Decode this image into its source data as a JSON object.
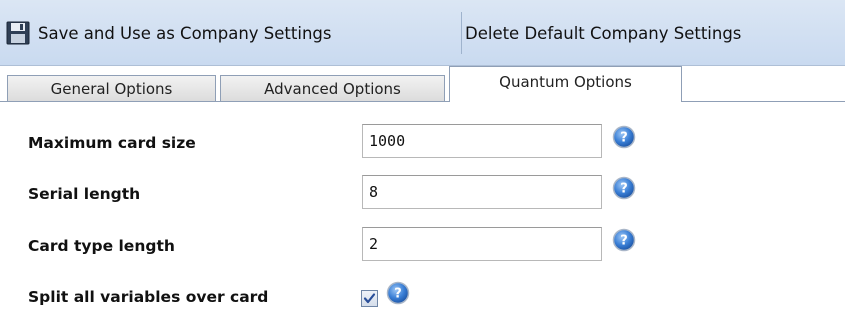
{
  "toolbar": {
    "save_label": "Save and Use as Company Settings",
    "save_icon": "floppy-disk-icon",
    "delete_label": "Delete Default Company Settings"
  },
  "tabs": [
    {
      "label": "General Options",
      "active": false
    },
    {
      "label": "Advanced Options",
      "active": false
    },
    {
      "label": "Quantum Options",
      "active": true
    }
  ],
  "form": {
    "max_card_size": {
      "label": "Maximum card size",
      "value": "1000",
      "help_icon": "help-question-icon"
    },
    "serial_length": {
      "label": "Serial length",
      "value": "8",
      "help_icon": "help-question-icon"
    },
    "card_type_length": {
      "label": "Card type length",
      "value": "2",
      "help_icon": "help-question-icon"
    },
    "split_variables": {
      "label": "Split all variables over card",
      "checked": true,
      "help_icon": "help-question-icon"
    }
  },
  "colors": {
    "toolbar_bg": "#c9daf0",
    "tab_border": "#8f9fb6",
    "help_icon_blue": "#2f6fc9",
    "checkmark": "#2a4f99"
  }
}
